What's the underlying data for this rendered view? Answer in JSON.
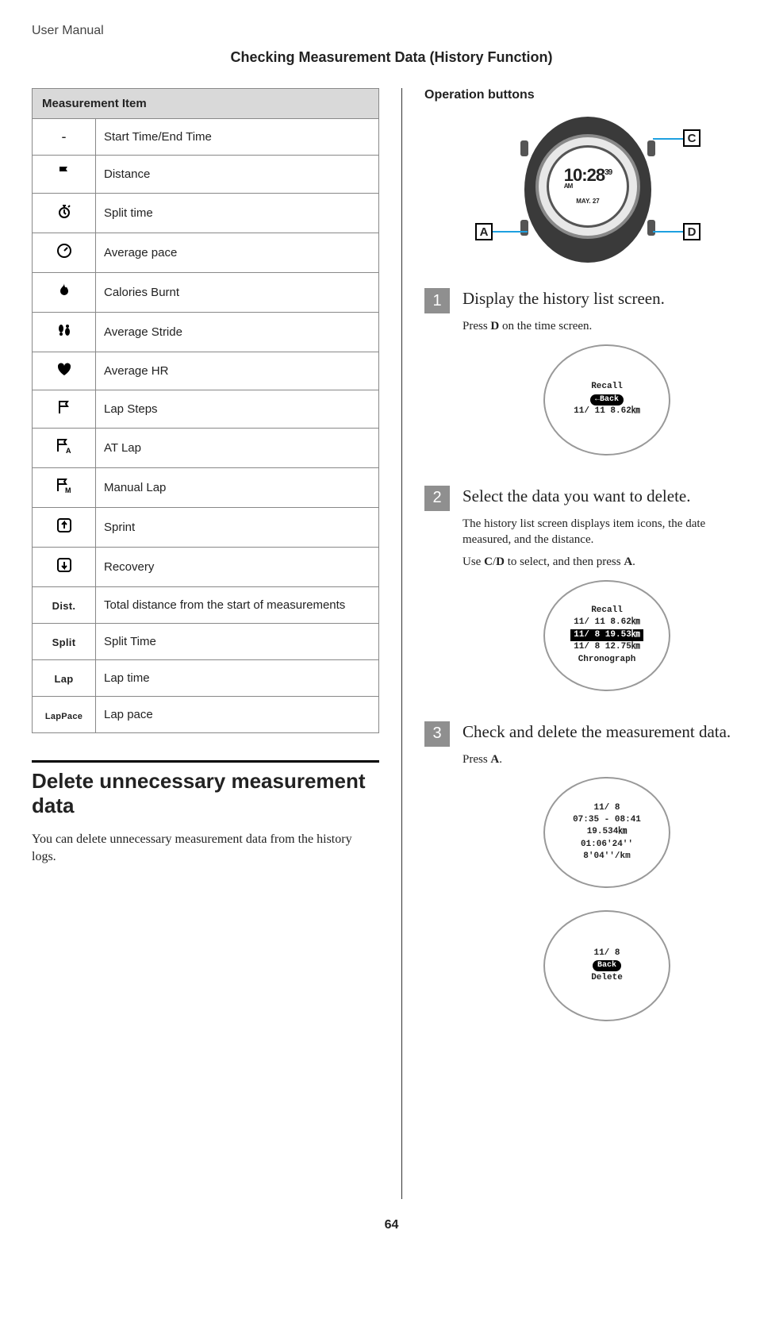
{
  "header": "User Manual",
  "title": "Checking Measurement Data (History Function)",
  "table": {
    "header": "Measurement Item",
    "rows": [
      {
        "icon": "-",
        "label": "Start Time/End Time"
      },
      {
        "icon": "flag",
        "label": "Distance"
      },
      {
        "icon": "stopwatch",
        "label": "Split time"
      },
      {
        "icon": "gauge",
        "label": "Average pace"
      },
      {
        "icon": "flame",
        "label": "Calories Burnt"
      },
      {
        "icon": "footsteps",
        "label": "Average Stride"
      },
      {
        "icon": "heart",
        "label": "Average HR"
      },
      {
        "icon": "flag-outline",
        "label": "Lap Steps"
      },
      {
        "icon": "flag-a",
        "label": "AT Lap"
      },
      {
        "icon": "flag-m",
        "label": "Manual Lap"
      },
      {
        "icon": "sprint",
        "label": "Sprint"
      },
      {
        "icon": "recovery",
        "label": "Recovery"
      },
      {
        "icon": "text-dist",
        "label": "Total distance from the start of measurements"
      },
      {
        "icon": "text-split",
        "label": "Split Time"
      },
      {
        "icon": "text-lap",
        "label": "Lap time"
      },
      {
        "icon": "text-lappace",
        "label": "Lap pace"
      }
    ]
  },
  "delete_section": {
    "heading": "Delete unnecessary measurement data",
    "body": "You can delete unnecessary measurement data from the history logs."
  },
  "right": {
    "op_header": "Operation buttons",
    "watch": {
      "time": "10:28",
      "sec": "39",
      "ampm": "AM",
      "date": "MAY. 27"
    },
    "callouts": {
      "a": "A",
      "c": "C",
      "d": "D"
    },
    "steps": [
      {
        "num": "1",
        "title": "Display the history list screen.",
        "lines": [
          "Press D on the time screen."
        ],
        "screens": [
          {
            "lines": [
              "Recall",
              "←Back",
              "11/ 11  8.62㎞"
            ],
            "pill_index": 1
          }
        ]
      },
      {
        "num": "2",
        "title": "Select the data you want to delete.",
        "lines": [
          "The history list screen displays item icons, the date measured, and the distance.",
          "Use C/D to select, and then press A."
        ],
        "screens": [
          {
            "lines": [
              "Recall",
              "11/ 11  8.62㎞",
              "11/  8 19.53㎞",
              "11/  8 12.75㎞",
              "Chronograph"
            ],
            "hilite_index": 2
          }
        ]
      },
      {
        "num": "3",
        "title": "Check and delete the measurement data.",
        "lines": [
          "Press A."
        ],
        "screens": [
          {
            "lines": [
              "11/  8",
              "07:35 - 08:41",
              "19.534㎞",
              "01:06'24''",
              "8'04''/km"
            ]
          },
          {
            "lines": [
              "11/  8",
              "",
              "Back",
              "Delete"
            ],
            "pill_index": 2
          }
        ]
      }
    ]
  },
  "page_number": "64",
  "icon_text": {
    "dist": "Dist.",
    "split": "Split",
    "lap": "Lap",
    "lappace": "LapPace"
  }
}
